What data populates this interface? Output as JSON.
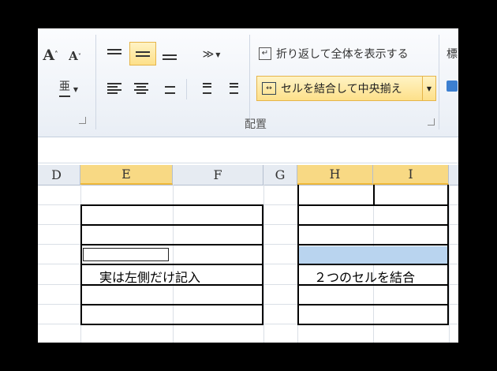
{
  "ribbon": {
    "font_grow_label": "A",
    "font_shrink_label": "A",
    "wrap_text_label": "折り返して全体を表示する",
    "merge_center_label": "セルを結合して中央揃え",
    "cut_off_label": "標",
    "alignment_group_label": "配置"
  },
  "columns": [
    {
      "label": "D",
      "selected": false
    },
    {
      "label": "E",
      "selected": true
    },
    {
      "label": "F",
      "selected": false
    },
    {
      "label": "G",
      "selected": false
    },
    {
      "label": "H",
      "selected": true
    },
    {
      "label": "I",
      "selected": true
    }
  ],
  "cells": {
    "left_note": "実は左側だけ記入",
    "right_note": "２つのセルを結合"
  },
  "colors": {
    "selected_header": "#f8d984",
    "merge_highlight": "#fde08a",
    "selected_cell_fill": "#b9d4ef"
  }
}
